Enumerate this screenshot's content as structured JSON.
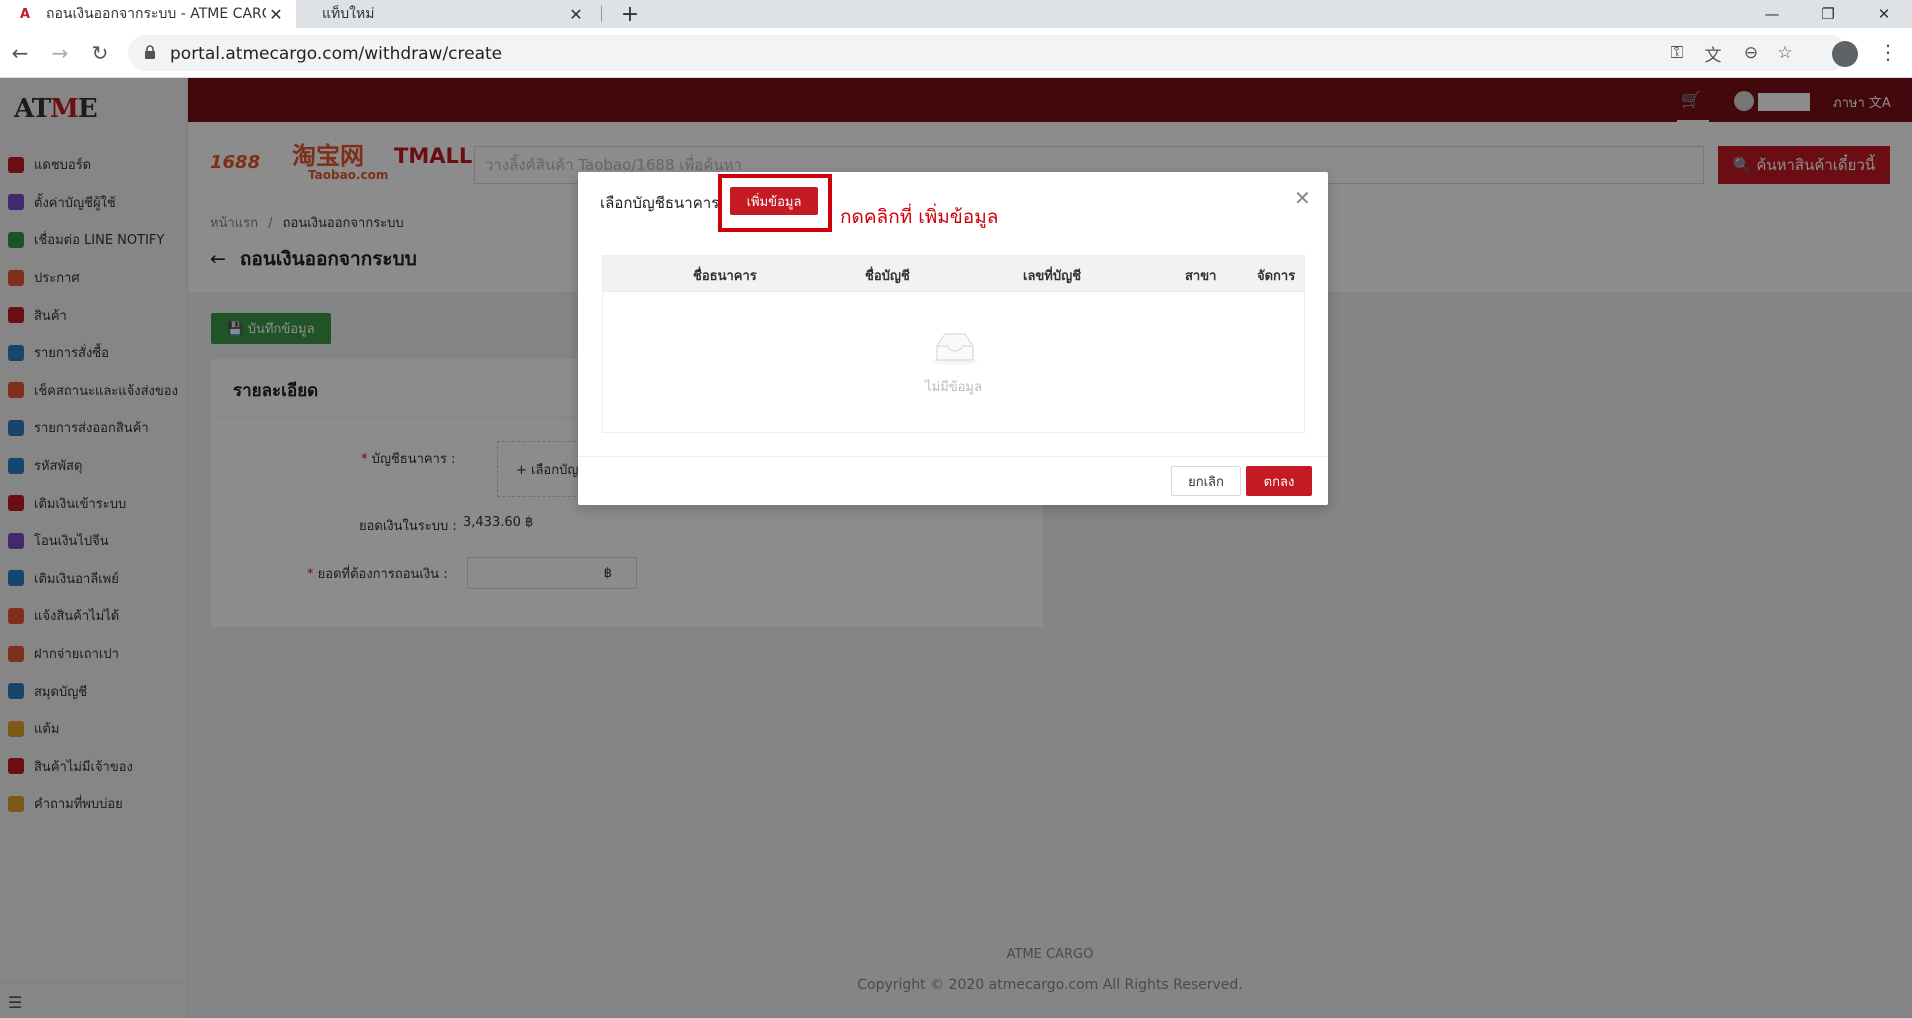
{
  "browser": {
    "tabs": [
      {
        "title": "ถอนเงินออกจากระบบ - ATME CARGO",
        "close": "✕"
      },
      {
        "title": "แท็บใหม่",
        "close": "✕"
      }
    ],
    "new_tab": "+",
    "url": "portal.atmecargo.com/withdraw/create",
    "window_controls": {
      "minimize": "—",
      "restore": "❐",
      "close": "✕"
    }
  },
  "app": {
    "logo_prefix": "AT",
    "logo_accent": "M",
    "logo_suffix": "E",
    "sidebar": [
      {
        "label": "แดชบอร์ด",
        "color": "#c41a24"
      },
      {
        "label": "ตั้งค่าบัญชีผู้ใช้",
        "color": "#7b4bc2"
      },
      {
        "label": "เชื่อมต่อ LINE NOTIFY",
        "color": "#2e9e3f"
      },
      {
        "label": "ประกาศ",
        "color": "#e4572e"
      },
      {
        "label": "สินค้า",
        "color": "#c41a24"
      },
      {
        "label": "รายการสั่งซื้อ",
        "color": "#2f7dc4"
      },
      {
        "label": "เช็คสถานะและแจ้งส่งของ",
        "color": "#e4572e"
      },
      {
        "label": "รายการส่งออกสินค้า",
        "color": "#2f7dc4"
      },
      {
        "label": "รหัสพัสดุ",
        "color": "#2f7dc4"
      },
      {
        "label": "เติมเงินเข้าระบบ",
        "color": "#c41a24"
      },
      {
        "label": "โอนเงินไปจีน",
        "color": "#7b4bc2"
      },
      {
        "label": "เติมเงินอาลีเพย์",
        "color": "#2f7dc4"
      },
      {
        "label": "แจ้งสินค้าไม่ได้",
        "color": "#e4572e"
      },
      {
        "label": "ฝากจ่ายเถาเปา",
        "color": "#e4572e"
      },
      {
        "label": "สมุดบัญชี",
        "color": "#2f7dc4"
      },
      {
        "label": "แต้ม",
        "color": "#e4a22e"
      },
      {
        "label": "สินค้าไม่มีเจ้าของ",
        "color": "#c41a24"
      },
      {
        "label": "คำถามที่พบบ่อย",
        "color": "#e4a22e"
      }
    ],
    "topbar": {
      "cart_icon": "🛒",
      "language": "ภาษา 文A"
    },
    "search": {
      "brand_1688": "1688",
      "brand_taobao_cn": "淘宝网",
      "brand_taobao": "Taobao.com",
      "brand_tmall": "TMALL",
      "placeholder": "วางลิ้งค์สินค้า Taobao/1688 เพื่อค้นหา",
      "button": "🔍 ค้นหาสินค้าเดี๋ยวนี้"
    },
    "breadcrumb": {
      "home": "หน้าแรก",
      "sep": "/",
      "current": "ถอนเงินออกจากระบบ"
    },
    "page_title": "ถอนเงินออกจากระบบ",
    "save_button": "💾 บันทึกข้อมูล",
    "card": {
      "title": "รายละเอียด",
      "bank_label": "บัญชีธนาคาร",
      "bank_picker": "+ เลือกบัญชี",
      "balance_label": "ยอดเงินในระบบ",
      "balance_value": "3,433.60 ฿",
      "amount_label": "ยอดที่ต้องการถอนเงิน",
      "amount_suffix": "฿"
    },
    "footer": {
      "brand": "ATME CARGO",
      "copyright": "Copyright © 2020 atmecargo.com All Rights Reserved."
    }
  },
  "modal": {
    "title": "เลือกบัญชีธนาคาร",
    "add_button": "เพิ่มข้อมูล",
    "annotation": "กดคลิกที่ เพิ่มข้อมูล",
    "columns": [
      "ชื่อธนาคาร",
      "ชื่อบัญชี",
      "เลขที่บัญชี",
      "สาขา",
      "จัดการ"
    ],
    "empty_text": "ไม่มีข้อมูล",
    "cancel": "ยกเลิก",
    "ok": "ตกลง"
  }
}
